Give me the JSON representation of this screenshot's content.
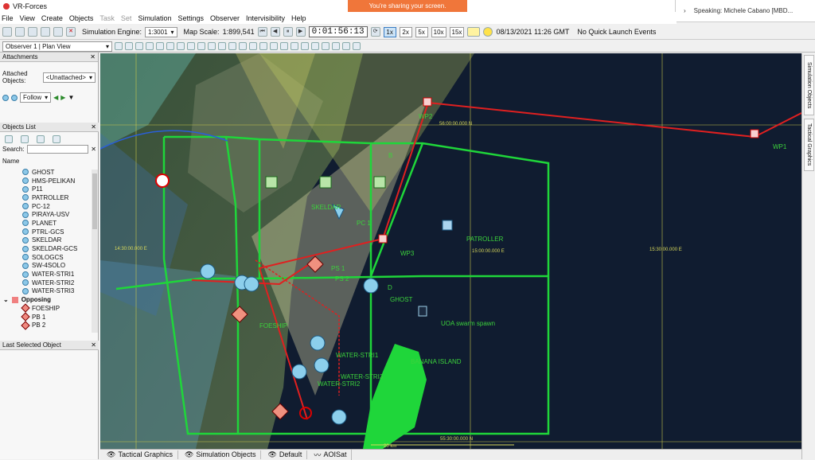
{
  "window": {
    "title": "VR-Forces"
  },
  "share_banner": "You're sharing your screen.",
  "speaker": "Speaking: Michele Cabano [MBD...",
  "menu": [
    "File",
    "View",
    "Create",
    "Objects",
    "Task",
    "Set",
    "Simulation",
    "Settings",
    "Observer",
    "Intervisibility",
    "Help"
  ],
  "toolbar": {
    "sim_engine_label": "Simulation Engine:",
    "sim_engine_value": "1:3001",
    "map_scale_label": "Map Scale:",
    "map_scale_value": "1:899,541",
    "sim_time": "0:01:56:13",
    "speeds": [
      "1x",
      "2x",
      "5x",
      "10x",
      "15x"
    ],
    "active_speed": "1x",
    "date": "08/13/2021 11:26 GMT",
    "quick_launch": "No Quick Launch Events"
  },
  "observer": {
    "label": "Observer 1",
    "view": "Plan View"
  },
  "attachments": {
    "title": "Attachments",
    "attached_label": "Attached Objects:",
    "attached_value": "<Unattached>",
    "follow_label": "Follow"
  },
  "objects_list": {
    "title": "Objects List",
    "search_label": "Search:",
    "column": "Name",
    "items": [
      "GHOST",
      "HMS-PELIKAN",
      "P11",
      "PATROLLER",
      "PC-12",
      "PIRAYA-USV",
      "PLANET",
      "PTRL-GCS",
      "SKELDAR",
      "SKELDAR-GCS",
      "SOLOGCS",
      "SW-4SOLO",
      "WATER-STRI1",
      "WATER-STRI2",
      "WATER-STRI3"
    ],
    "group_opposing": "Opposing",
    "opposing_items": [
      "FOESHIP",
      "PB 1",
      "PB 2"
    ]
  },
  "last_selected": {
    "title": "Last Selected Object"
  },
  "right_tabs": [
    "Simulation Objects",
    "Tactical Graphics"
  ],
  "bottom_tabs": [
    "Tactical Graphics",
    "Simulation Objects",
    "Default",
    "AOISat"
  ],
  "map_labels": {
    "wp2": "WP2",
    "wp1": "WP1",
    "wp3": "WP3",
    "coord_n1": "56:00:00.000 N",
    "coord_n2": "55:30:00.000 N",
    "coord_e1": "14:30:00.000 E",
    "coord_e2": "15:00:00.000 E",
    "coord_e3": "15:30:00.000 E",
    "patroller": "PATROLLER",
    "ghost": "GHOST",
    "uoa": "UOA swarm spawn",
    "banana": "BANANA ISLAND",
    "foeship": "FOESHIP",
    "water1": "WATER-STRI1",
    "water2": "WATER-STRI2",
    "water3": "WATER-STRI3",
    "skeldar": "SKELDAR",
    "ps1": "PS 1",
    "ps2": "PS 2",
    "pc": "PC 1",
    "b": "B",
    "d": "D",
    "scale": "20 km"
  }
}
